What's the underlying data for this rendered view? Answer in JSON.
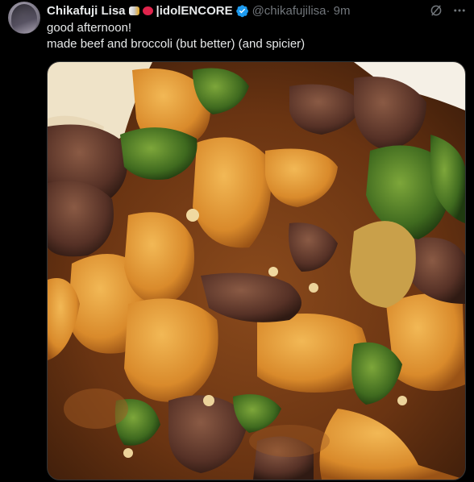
{
  "post": {
    "author_name": "Chikafuji Lisa",
    "org": "idolENCORE",
    "handle": "@chikafujilisa",
    "time": "· 9m",
    "text_line1": "good afternoon!",
    "text_line2": "made beef and broccoli (but better) (and spicier)"
  },
  "icons": {
    "verified": "verified-badge-icon",
    "grok": "grok-icon",
    "more": "more-options-icon"
  },
  "colors": {
    "background": "#000000",
    "text": "#e7e9ea",
    "muted": "#71767b",
    "verified": "#1d9bf0"
  }
}
